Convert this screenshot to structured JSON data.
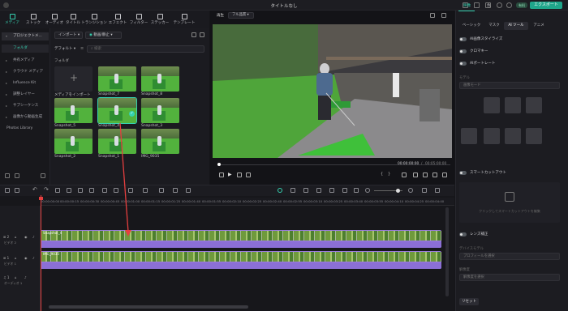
{
  "app": {
    "title": "タイトルなし",
    "export_label": "エクスポート",
    "paid_label": "有料"
  },
  "toptabs": [
    {
      "label": "メディア",
      "active": true
    },
    {
      "label": "ストック",
      "active": false
    },
    {
      "label": "オーディオ",
      "active": false
    },
    {
      "label": "タイトル",
      "active": false
    },
    {
      "label": "トランジション",
      "active": false
    },
    {
      "label": "エフェクト",
      "active": false
    },
    {
      "label": "フィルター",
      "active": false
    },
    {
      "label": "ステッカー",
      "active": false
    },
    {
      "label": "テンプレート",
      "active": false
    }
  ],
  "sidebar": {
    "header": "プロジェクトメ...",
    "folder": "フォルダ",
    "items": [
      "共有メディア",
      "クラウド メディア",
      "Influence Kit",
      "調整レイヤー",
      "サブシーケンス",
      "画像から動画生成",
      "Photos Library"
    ]
  },
  "media": {
    "import_label": "インポート",
    "filter_label": "動画/静止",
    "sort_label": "デフォルト",
    "search_placeholder": "検索",
    "folder_label": "フォルダ",
    "import_tile": "メディアをインポート",
    "thumbs": [
      "Snapshot_7",
      "Snapshot_8",
      "Snapshot_5",
      "Snapshot_4",
      "Snapshot_3",
      "Snapshot_2",
      "Snapshot_1",
      "IMG_9035"
    ],
    "selected": "Snapshot_4"
  },
  "preview": {
    "player_label": "再生",
    "quality_label": "フル品質",
    "timecode": "00:00:00:00",
    "duration": "00:05:00:00"
  },
  "right": {
    "tabs": [
      "映像",
      "色"
    ],
    "subtabs": [
      "ベーシック",
      "マスク",
      "AI ツール",
      "アニメ"
    ],
    "ai_stabilize": "AI画像スタイライズ",
    "chroma": "クロマキー",
    "ai_portrait": "AIポートレート",
    "model_label": "モデル",
    "model_placeholder": "画像モード",
    "smart_cutout": "スマートカットアウト",
    "smart_cutout_hint": "クリックしてスマートカットアウトを編集",
    "lens_label": "レンズ補正",
    "device_label": "デバイスモデル",
    "device_placeholder": "プロフィールを選択",
    "resolution_label": "解像度",
    "resolution_placeholder": "解像度を選択",
    "reset_label": "リセット"
  },
  "timeline": {
    "ruler": [
      "00:00:00:00",
      "00:00:00:15",
      "00:00:00:30",
      "00:00:00:45",
      "00:00:01:00",
      "00:00:01:15",
      "00:00:01:25",
      "00:00:01:40",
      "00:00:01:55",
      "00:00:02:10",
      "00:00:02:25",
      "00:00:02:40",
      "00:00:02:55",
      "00:00:03:10",
      "00:00:03:25",
      "00:00:03:40",
      "00:00:03:55",
      "00:00:04:10",
      "00:00:04:25",
      "00:00:04:40"
    ],
    "tracks": [
      {
        "label": "ビデオ 2",
        "clip": "Snapshot_4"
      },
      {
        "label": "ビデオ 1",
        "clip": "IMG_9035"
      },
      {
        "label": "オーディオ 1",
        "clip": ""
      }
    ]
  },
  "colors": {
    "accent": "#35d1b0",
    "playhead": "#e53f3f",
    "clip": "#9a7ae0",
    "export": "#1fa58a"
  }
}
